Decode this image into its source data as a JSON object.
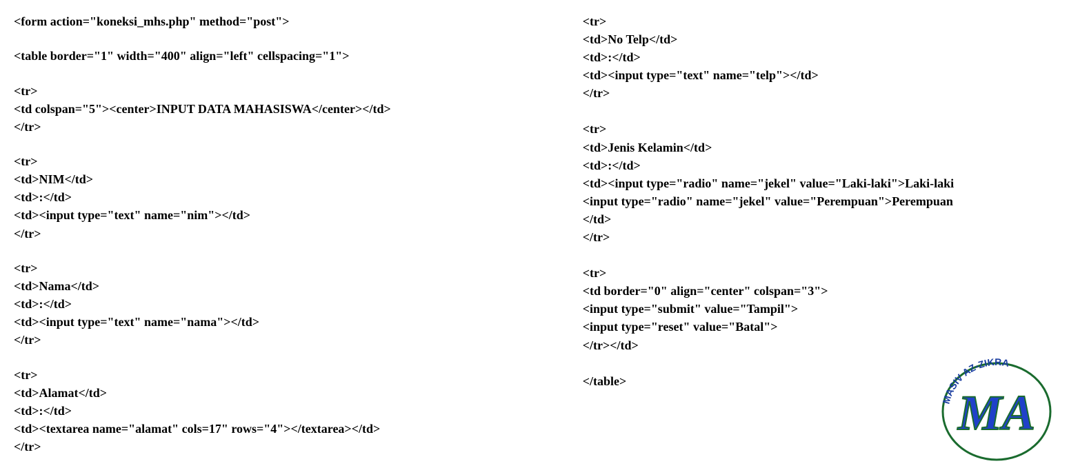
{
  "left": {
    "l1": "<form action=\"koneksi_mhs.php\" method=\"post\">",
    "l2": "<table border=\"1\" width=\"400\" align=\"left\" cellspacing=\"1\">",
    "l3": "<tr>",
    "l4": "<td colspan=\"5\"><center>INPUT DATA MAHASISWA</center></td>",
    "l5": "</tr>",
    "l6": "<tr>",
    "l7": "<td>NIM</td>",
    "l8": "<td>:</td>",
    "l9": "<td><input type=\"text\" name=\"nim\"></td>",
    "l10": "</tr>",
    "l11": "<tr>",
    "l12": "<td>Nama</td>",
    "l13": "<td>:</td>",
    "l14": "<td><input type=\"text\" name=\"nama\"></td>",
    "l15": "</tr>",
    "l16": "<tr>",
    "l17": "<td>Alamat</td>",
    "l18": "<td>:</td>",
    "l19": "<td><textarea name=\"alamat\" cols=17\" rows=\"4\"></textarea></td>",
    "l20": "</tr>"
  },
  "right": {
    "r1": "<tr>",
    "r2": "<td>No Telp</td>",
    "r3": "<td>:</td>",
    "r4": "<td><input type=\"text\" name=\"telp\"></td>",
    "r5": "</tr>",
    "r6": "<tr>",
    "r7": "<td>Jenis Kelamin</td>",
    "r8": "<td>:</td>",
    "r9": "<td><input type=\"radio\" name=\"jekel\" value=\"Laki-laki\">Laki-laki",
    "r10": "<input type=\"radio\" name=\"jekel\" value=\"Perempuan\">Perempuan",
    "r11": "</td>",
    "r12": "</tr>",
    "r13": "<tr>",
    "r14": "<td border=\"0\" align=\"center\" colspan=\"3\">",
    "r15": "<input type=\"submit\" value=\"Tampil\">",
    "r16": "<input type=\"reset\" value=\"Batal\">",
    "r17": "</tr></td>",
    "r18": "</table>"
  },
  "logo": {
    "top_text": "MASIV AZ-ZIKRA",
    "big_text": "MA"
  }
}
